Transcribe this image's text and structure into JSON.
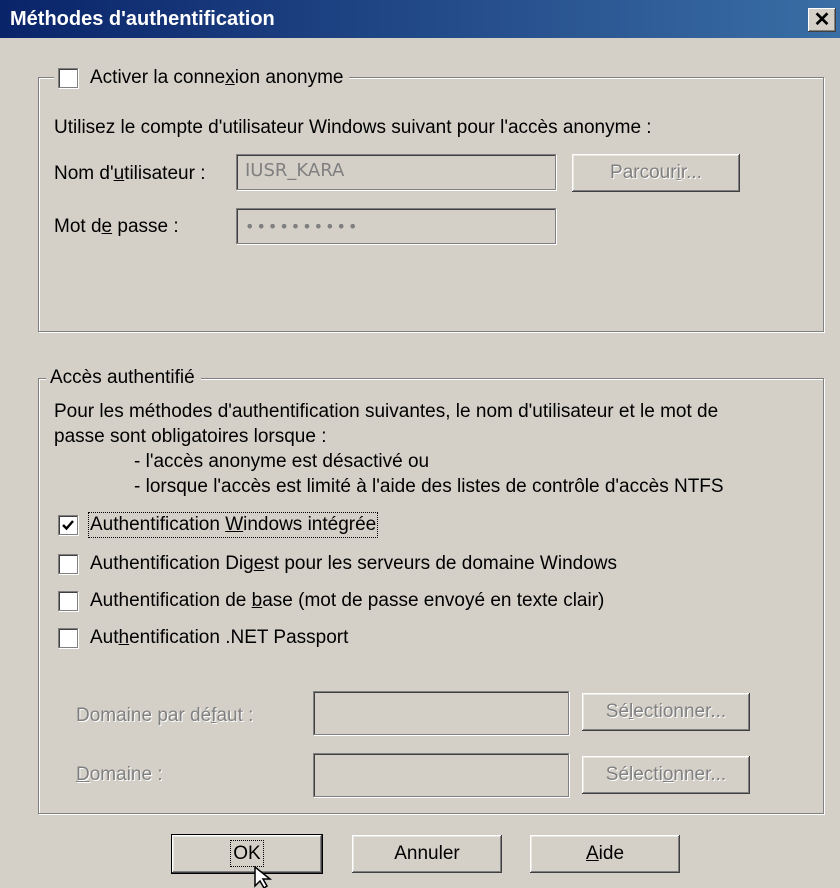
{
  "window": {
    "title": "Méthodes d'authentification",
    "close_glyph": "✕"
  },
  "anonymous": {
    "legend_pre": "Activer la conne",
    "legend_acc": "x",
    "legend_post": "ion anonyme",
    "checked": false,
    "description": "Utilisez le compte d'utilisateur Windows suivant pour l'accès anonyme :",
    "username_label_pre": "Nom d'",
    "username_label_acc": "u",
    "username_label_post": "tilisateur :",
    "username_value": "IUSR_KARA",
    "browse_pre": "Parcour",
    "browse_acc": "i",
    "browse_post": "r...",
    "password_label_pre": "Mot d",
    "password_label_acc": "e",
    "password_label_post": " passe :",
    "password_value": "••••••••••"
  },
  "authenticated": {
    "legend": "Accès authentifié",
    "desc_line1": "Pour les méthodes d'authentification suivantes, le nom d'utilisateur et le mot de",
    "desc_line2": "passe sont obligatoires lorsque :",
    "bullet1": "- l'accès anonyme est désactivé ou",
    "bullet2": "- lorsque l'accès est limité à l'aide des listes de contrôle d'accès NTFS",
    "options": [
      {
        "pre": "Authentification ",
        "acc": "W",
        "post": "indows intégrée",
        "checked": true
      },
      {
        "pre": "Authentification Dig",
        "acc": "e",
        "post": "st pour les serveurs de domaine Windows",
        "checked": false
      },
      {
        "pre": "Authentification de ",
        "acc": "b",
        "post": "ase (mot de passe envoyé en texte clair)",
        "checked": false
      },
      {
        "pre": "Aut",
        "acc": "h",
        "post": "entification .NET Passport",
        "checked": false
      }
    ],
    "default_domain_pre": "Domaine par dé",
    "default_domain_acc": "f",
    "default_domain_post": "aut :",
    "realm_pre": "",
    "realm_acc": "D",
    "realm_post": "omaine :",
    "select1_pre": "Sé",
    "select1_acc": "l",
    "select1_post": "ectionner...",
    "select2_pre": "Sélecti",
    "select2_acc": "o",
    "select2_post": "nner..."
  },
  "buttons": {
    "ok": "OK",
    "cancel": "Annuler",
    "help_acc": "A",
    "help_post": "ide"
  }
}
